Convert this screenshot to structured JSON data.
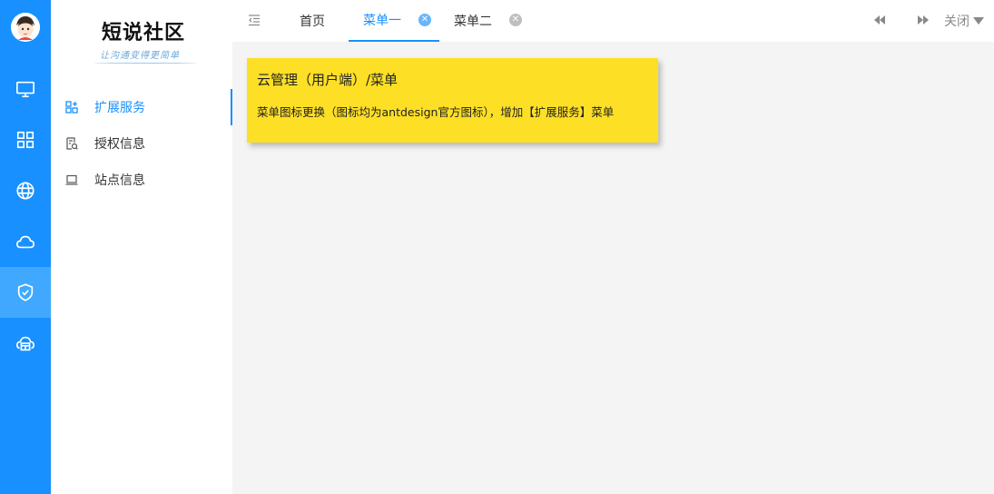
{
  "logo": {
    "title": "短说社区",
    "subtitle": "让沟通变得更简单"
  },
  "rail": {
    "items": [
      {
        "icon": "monitor-icon"
      },
      {
        "icon": "apps-grid-icon"
      },
      {
        "icon": "globe-icon"
      },
      {
        "icon": "cloud-icon"
      },
      {
        "icon": "shield-check-icon",
        "active": true
      },
      {
        "icon": "cloud-store-icon"
      }
    ],
    "accent": "#1890ff",
    "active_bg": "#40a9ff"
  },
  "sidebar": {
    "items": [
      {
        "label": "扩展服务",
        "icon": "expand-icon",
        "active": true
      },
      {
        "label": "授权信息",
        "icon": "authorization-icon"
      },
      {
        "label": "站点信息",
        "icon": "laptop-icon"
      }
    ]
  },
  "tabs": [
    {
      "label": "首页"
    },
    {
      "label": "菜单一",
      "active": true,
      "closable": true
    },
    {
      "label": "菜单二",
      "closable": true
    }
  ],
  "toolbar": {
    "close_all_label": "关闭"
  },
  "card": {
    "title": "云管理（用户端）/菜单",
    "body": "菜单图标更换（图标均为antdesign官方图标），增加【扩展服务】菜单",
    "background": "#fddf25"
  }
}
